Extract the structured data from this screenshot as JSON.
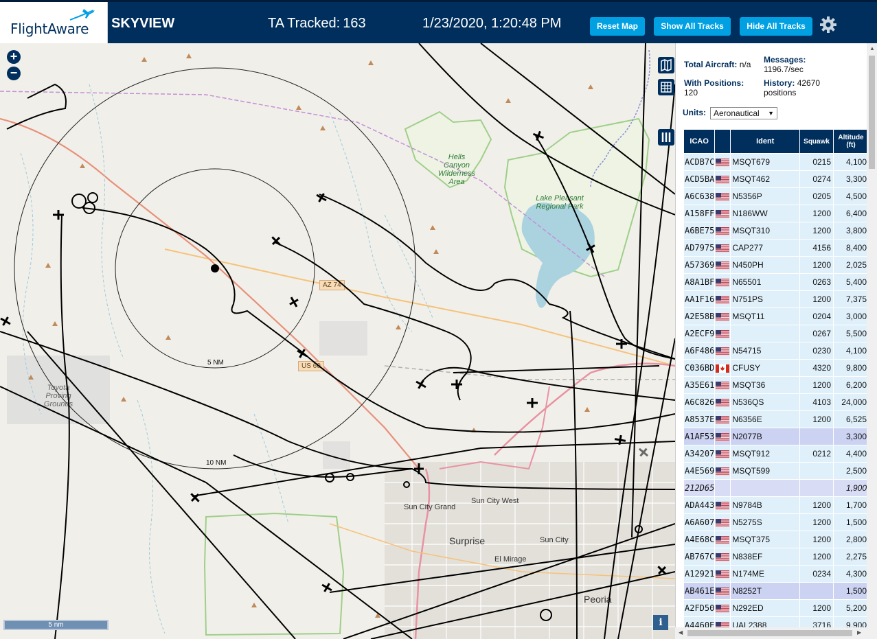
{
  "header": {
    "logo_text": "FlightAware",
    "app_title": "SKYVIEW",
    "tracked_label": "TA Tracked:",
    "tracked_count": "163",
    "datetime": "1/23/2020, 1:20:48 PM",
    "buttons": {
      "reset_map": "Reset Map",
      "show_all_tracks": "Show All Tracks",
      "hide_all_tracks": "Hide All Tracks"
    },
    "settings_icon": "gear-icon"
  },
  "map": {
    "zoom_in": "+",
    "zoom_out": "−",
    "labels": {
      "hells_canyon": "Hells Canyon Wilderness Area",
      "lake_pleasant": "Lake Pleasant Regional Park",
      "toyota": "Toyota Proving Grounds",
      "sun_city_grand": "Sun City Grand",
      "sun_city_west": "Sun City West",
      "surprise": "Surprise",
      "sun_city": "Sun City",
      "el_mirage": "El Mirage",
      "peoria": "Peoria",
      "az74": "AZ 74",
      "us60": "US 60"
    },
    "ring_labels": {
      "inner": "5 NM",
      "outer": "10 NM"
    },
    "scale_label": "5 nm",
    "info_button": "i",
    "colors": {
      "land": "#f1efe9",
      "water": "#aad3df",
      "park": "#9fcf8a",
      "track": "#000000",
      "highway": "#e892a2"
    }
  },
  "sidebar": {
    "stats": {
      "total_aircraft_label": "Total Aircraft:",
      "total_aircraft_value": "n/a",
      "messages_label": "Messages:",
      "messages_value": "1196.7/sec",
      "with_positions_label": "With Positions:",
      "with_positions_value": "120",
      "history_label": "History:",
      "history_value": "42670",
      "history_unit": "positions"
    },
    "units_label": "Units:",
    "units_value": "Aeronautical",
    "columns": [
      "ICAO",
      "",
      "Ident",
      "Squawk",
      "Altitude (ft)"
    ],
    "rows": [
      {
        "icao": "ACDB7C",
        "country": "US",
        "ident": "MSQT679",
        "squawk": "0215",
        "alt": "4,100"
      },
      {
        "icao": "ACD5BA",
        "country": "US",
        "ident": "MSQT462",
        "squawk": "0274",
        "alt": "3,300"
      },
      {
        "icao": "A6C638",
        "country": "US",
        "ident": "N5356P",
        "squawk": "0205",
        "alt": "4,500"
      },
      {
        "icao": "A158FF",
        "country": "US",
        "ident": "N186WW",
        "squawk": "1200",
        "alt": "6,400"
      },
      {
        "icao": "A6BE75",
        "country": "US",
        "ident": "MSQT310",
        "squawk": "1200",
        "alt": "3,800"
      },
      {
        "icao": "AD7975",
        "country": "US",
        "ident": "CAP277",
        "squawk": "4156",
        "alt": "8,400"
      },
      {
        "icao": "A57369",
        "country": "US",
        "ident": "N450PH",
        "squawk": "1200",
        "alt": "2,025"
      },
      {
        "icao": "A8A1BF",
        "country": "US",
        "ident": "N65501",
        "squawk": "0263",
        "alt": "5,400"
      },
      {
        "icao": "AA1F16",
        "country": "US",
        "ident": "N751PS",
        "squawk": "1200",
        "alt": "7,375"
      },
      {
        "icao": "A2E58B",
        "country": "US",
        "ident": "MSQT11",
        "squawk": "0204",
        "alt": "3,000"
      },
      {
        "icao": "A2ECF9",
        "country": "US",
        "ident": "",
        "squawk": "0267",
        "alt": "5,500"
      },
      {
        "icao": "A6F486",
        "country": "US",
        "ident": "N54715",
        "squawk": "0230",
        "alt": "4,100"
      },
      {
        "icao": "C036BD",
        "country": "CA",
        "ident": "CFUSY",
        "squawk": "4320",
        "alt": "9,800"
      },
      {
        "icao": "A35E61",
        "country": "US",
        "ident": "MSQT36",
        "squawk": "1200",
        "alt": "6,200"
      },
      {
        "icao": "A6C826",
        "country": "US",
        "ident": "N536QS",
        "squawk": "4103",
        "alt": "24,000"
      },
      {
        "icao": "A8537E",
        "country": "US",
        "ident": "N6356E",
        "squawk": "1200",
        "alt": "6,525"
      },
      {
        "icao": "A1AF53",
        "country": "US",
        "ident": "N2077B",
        "squawk": "",
        "alt": "3,300",
        "highlight": true
      },
      {
        "icao": "A34207",
        "country": "US",
        "ident": "MSQT912",
        "squawk": "0212",
        "alt": "4,400"
      },
      {
        "icao": "A4E569",
        "country": "US",
        "ident": "MSQT599",
        "squawk": "",
        "alt": "2,500"
      },
      {
        "icao": "212D65",
        "country": "",
        "ident": "",
        "squawk": "",
        "alt": "1,900",
        "mlat": true
      },
      {
        "icao": "ADA443",
        "country": "US",
        "ident": "N9784B",
        "squawk": "1200",
        "alt": "1,700"
      },
      {
        "icao": "A6A607",
        "country": "US",
        "ident": "N5275S",
        "squawk": "1200",
        "alt": "1,500"
      },
      {
        "icao": "A4E68C",
        "country": "US",
        "ident": "MSQT375",
        "squawk": "1200",
        "alt": "2,800"
      },
      {
        "icao": "AB767C",
        "country": "US",
        "ident": "N838EF",
        "squawk": "1200",
        "alt": "2,275"
      },
      {
        "icao": "A12921",
        "country": "US",
        "ident": "N174ME",
        "squawk": "0234",
        "alt": "4,300"
      },
      {
        "icao": "AB461E",
        "country": "US",
        "ident": "N8252T",
        "squawk": "",
        "alt": "1,500",
        "highlight": true
      },
      {
        "icao": "A2FD50",
        "country": "US",
        "ident": "N292ED",
        "squawk": "1200",
        "alt": "5,200"
      },
      {
        "icao": "A4460E",
        "country": "US",
        "ident": "UAL2388",
        "squawk": "3716",
        "alt": "9,900"
      }
    ]
  }
}
